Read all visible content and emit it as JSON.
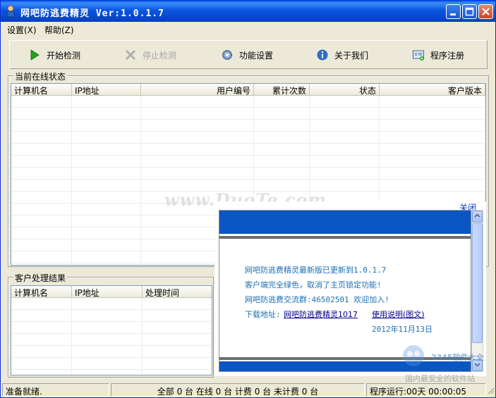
{
  "window": {
    "title": "网吧防逃费精灵  Ver:1.0.1.7"
  },
  "menu": [
    {
      "label": "设置(X)"
    },
    {
      "label": "帮助(Z)"
    }
  ],
  "toolbar": [
    {
      "label": "开始检测",
      "icon": "play-icon",
      "enabled": true
    },
    {
      "label": "停止检测",
      "icon": "stop-x-icon",
      "enabled": false
    },
    {
      "label": "功能设置",
      "icon": "gear-icon",
      "enabled": true
    },
    {
      "label": "关于我们",
      "icon": "info-icon",
      "enabled": true
    },
    {
      "label": "程序注册",
      "icon": "register-icon",
      "enabled": true
    }
  ],
  "online": {
    "group_label": "当前在线状态",
    "columns": [
      "计算机名",
      "IP地址",
      "用户编号",
      "累计次数",
      "状态",
      "客户版本"
    ],
    "rows": []
  },
  "results": {
    "group_label": "客户处理结果",
    "columns": [
      "计算机名",
      "IP地址",
      "处理时间"
    ],
    "rows": []
  },
  "popup": {
    "close_label": "关闭",
    "lines": [
      "网吧防逃费精灵最新版已更新到1.0.1.7",
      "客户端完全绿色，取消了主页锁定功能!",
      "网吧防逃费交流群:46502501 欢迎加入!"
    ],
    "download_prefix": "下载地址:",
    "download_link": "网吧防逃费精灵1017",
    "manual_link": "使用说明(图文)",
    "date": "2012年11月13日"
  },
  "status": {
    "ready": "准备就绪.",
    "counts": "全部 0 台 在线 0 台 计费 0 台 未计费 0 台",
    "runtime": "程序运行:00天 00:00:05"
  },
  "watermark": {
    "site": "www.DuoTe.com",
    "brand": "国内最安全的软件站",
    "logo_text": "2345软件大全"
  },
  "colors": {
    "titlebar": "#0a55e1",
    "popup_band": "#0a56c4",
    "popup_text": "#1c6fb6"
  }
}
